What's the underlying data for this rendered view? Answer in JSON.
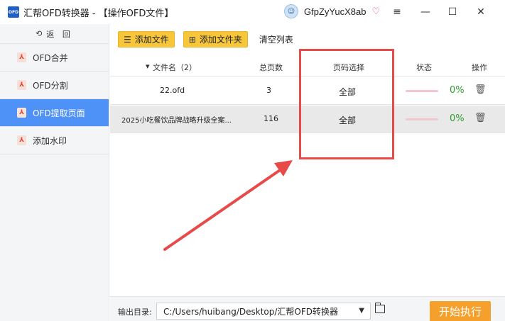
{
  "window": {
    "title": "汇帮OFD转换器 - 【操作OFD文件】",
    "logo_text": "OFD",
    "username": "GfpZyYucX8ab",
    "controls": {
      "menu": "≡",
      "minimize": "—",
      "maximize": "☐",
      "close": "✕"
    }
  },
  "sidebar": {
    "back_label": "返 回",
    "items": [
      {
        "label": "OFD合并",
        "active": false
      },
      {
        "label": "OFD分割",
        "active": false
      },
      {
        "label": "OFD提取页面",
        "active": true
      },
      {
        "label": "添加水印",
        "active": false
      }
    ]
  },
  "toolbar": {
    "add_file_label": "添加文件",
    "add_folder_label": "添加文件夹",
    "clear_label": "清空列表"
  },
  "table": {
    "columns": {
      "filename": "文件名（2）",
      "total_pages": "总页数",
      "page_select": "页码选择",
      "status": "状态",
      "action": "操作"
    },
    "rows": [
      {
        "filename": "22.ofd",
        "total_pages": "3",
        "page_select": "全部",
        "progress": "0%",
        "selected": false
      },
      {
        "filename": "2025小吃餐饮品牌战略升级全案...",
        "total_pages": "116",
        "page_select": "全部",
        "progress": "0%",
        "selected": true
      }
    ]
  },
  "footer": {
    "output_label": "输出目录:",
    "output_path": "C:/Users/huibang/Desktop/汇帮OFD转换器",
    "start_label": "开始执行"
  },
  "colors": {
    "accent_blue": "#4f92f7",
    "button_yellow": "#f8c63a",
    "start_orange": "#f5a02c",
    "annotation_red": "#e84a4a",
    "progress_green": "#2e9e2e"
  }
}
